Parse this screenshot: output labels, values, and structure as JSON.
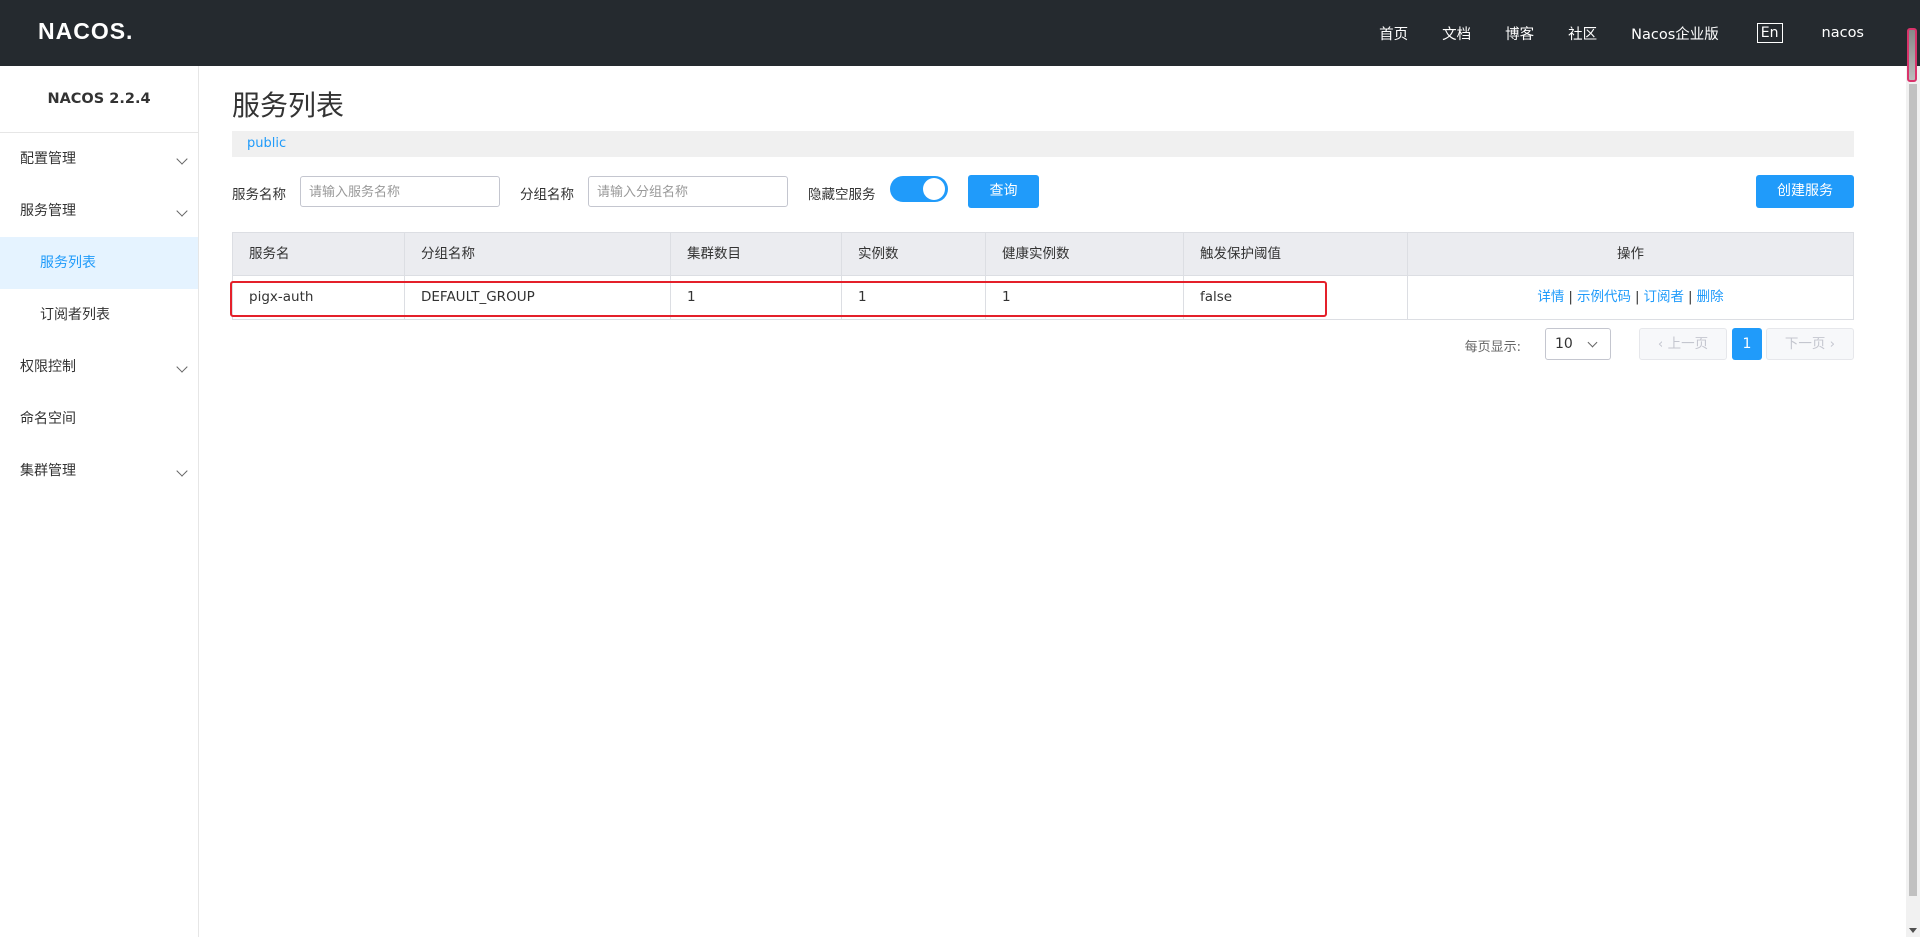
{
  "header": {
    "logo": "NACOS.",
    "nav": [
      "首页",
      "文档",
      "博客",
      "社区",
      "Nacos企业版"
    ],
    "lang": "En",
    "user": "nacos"
  },
  "sidebar": {
    "version": "NACOS 2.2.4",
    "items": [
      {
        "label": "配置管理",
        "expandable": true
      },
      {
        "label": "服务管理",
        "expandable": true
      },
      {
        "label": "服务列表",
        "sub": true,
        "active": true
      },
      {
        "label": "订阅者列表",
        "sub": true
      },
      {
        "label": "权限控制",
        "expandable": true
      },
      {
        "label": "命名空间"
      },
      {
        "label": "集群管理",
        "expandable": true
      }
    ]
  },
  "main": {
    "title": "服务列表",
    "namespace": "public",
    "filter": {
      "service_label": "服务名称",
      "service_placeholder": "请输入服务名称",
      "group_label": "分组名称",
      "group_placeholder": "请输入分组名称",
      "hide_empty_label": "隐藏空服务",
      "hide_empty_on": true,
      "query_button": "查询",
      "create_button": "创建服务"
    },
    "table": {
      "headers": [
        "服务名",
        "分组名称",
        "集群数目",
        "实例数",
        "健康实例数",
        "触发保护阈值",
        "操作"
      ],
      "rows": [
        {
          "name": "pigx-auth",
          "group": "DEFAULT_GROUP",
          "clusters": "1",
          "instances": "1",
          "healthy": "1",
          "threshold": "false"
        }
      ],
      "actions": [
        "详情",
        "示例代码",
        "订阅者",
        "删除"
      ],
      "action_sep": "|"
    },
    "pager": {
      "page_size_label": "每页显示:",
      "page_size": "10",
      "prev": "上一页",
      "current": "1",
      "next": "下一页"
    }
  },
  "colors": {
    "topbar": "#252a2f",
    "accent": "#209bfa",
    "highlight": "#e4202a"
  }
}
